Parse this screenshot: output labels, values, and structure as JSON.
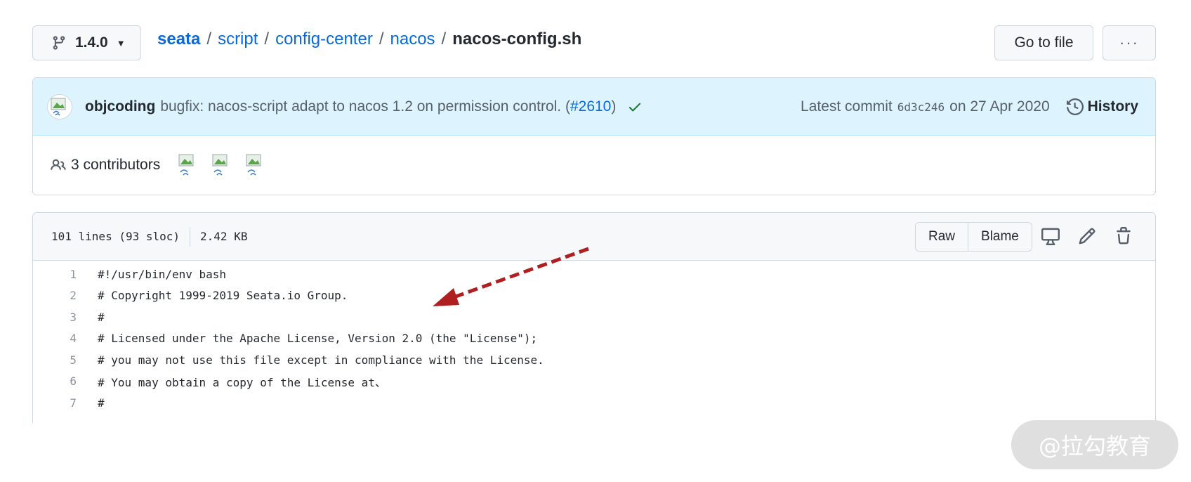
{
  "toolbar": {
    "branch": "1.4.0",
    "breadcrumb": [
      {
        "label": "seata"
      },
      {
        "label": "script"
      },
      {
        "label": "config-center"
      },
      {
        "label": "nacos"
      }
    ],
    "separator": "/",
    "current_file": "nacos-config.sh",
    "go_to_file": "Go to file",
    "more": "···"
  },
  "commit": {
    "author": "objcoding",
    "message": "bugfix: nacos-script adapt to nacos 1.2 on permission control. (",
    "pr_link": "#2610",
    "message_end": ")",
    "latest_label": "Latest commit",
    "sha": "6d3c246",
    "date": "on 27 Apr 2020",
    "history": "History"
  },
  "contributors": {
    "label": "3 contributors",
    "count": 3
  },
  "file": {
    "lines_info": "101 lines (93 sloc)",
    "size": "2.42 KB",
    "raw": "Raw",
    "blame": "Blame"
  },
  "code_lines": [
    {
      "num": "1",
      "text": "#!/usr/bin/env bash"
    },
    {
      "num": "2",
      "text": "# Copyright 1999-2019 Seata.io Group."
    },
    {
      "num": "3",
      "text": "#"
    },
    {
      "num": "4",
      "text": "# Licensed under the Apache License, Version 2.0 (the \"License\");"
    },
    {
      "num": "5",
      "text": "# you may not use this file except in compliance with the License."
    },
    {
      "num": "6",
      "text": "# You may obtain a copy of the License at、"
    },
    {
      "num": "7",
      "text": "#"
    }
  ],
  "watermark": "@拉勾教育",
  "colors": {
    "link": "#0969da",
    "commit_bg": "#ddf4ff",
    "success": "#1a7f37",
    "annotation_arrow": "#b01f1f"
  }
}
